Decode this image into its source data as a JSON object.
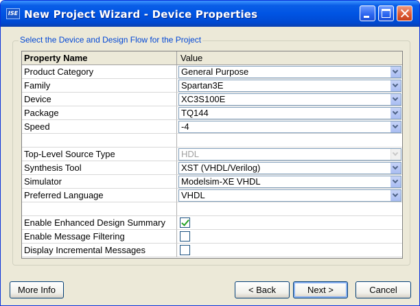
{
  "window": {
    "title": "New Project Wizard - Device Properties",
    "icon_label": "ISE"
  },
  "group": {
    "legend": "Select the Device and Design Flow for the Project"
  },
  "grid": {
    "header": {
      "name": "Property Name",
      "value": "Value"
    },
    "rows": [
      {
        "name": "Product Category",
        "value": "General Purpose"
      },
      {
        "name": "Family",
        "value": "Spartan3E"
      },
      {
        "name": "Device",
        "value": "XC3S100E"
      },
      {
        "name": "Package",
        "value": "TQ144"
      },
      {
        "name": "Speed",
        "value": "-4"
      },
      {
        "name": "",
        "value": ""
      },
      {
        "name": "Top-Level Source Type",
        "value": "HDL",
        "disabled": true
      },
      {
        "name": "Synthesis Tool",
        "value": "XST (VHDL/Verilog)"
      },
      {
        "name": "Simulator",
        "value": "Modelsim-XE VHDL"
      },
      {
        "name": "Preferred Language",
        "value": "VHDL"
      },
      {
        "name": "",
        "value": ""
      },
      {
        "name": "Enable Enhanced Design Summary",
        "checked": true
      },
      {
        "name": "Enable Message Filtering",
        "checked": false
      },
      {
        "name": "Display Incremental Messages",
        "checked": false
      }
    ]
  },
  "buttons": {
    "more_info": "More Info",
    "back": "< Back",
    "next": "Next >",
    "cancel": "Cancel"
  },
  "icons": {
    "minimize": "minimize-icon",
    "maximize": "maximize-icon",
    "close": "close-icon",
    "dropdown": "chevron-down-icon",
    "checkmark": "check-icon"
  },
  "colors": {
    "titlebar": "#0054e3",
    "dialog_bg": "#ece9d8",
    "legend_text": "#0046d5",
    "check": "#21a121"
  }
}
